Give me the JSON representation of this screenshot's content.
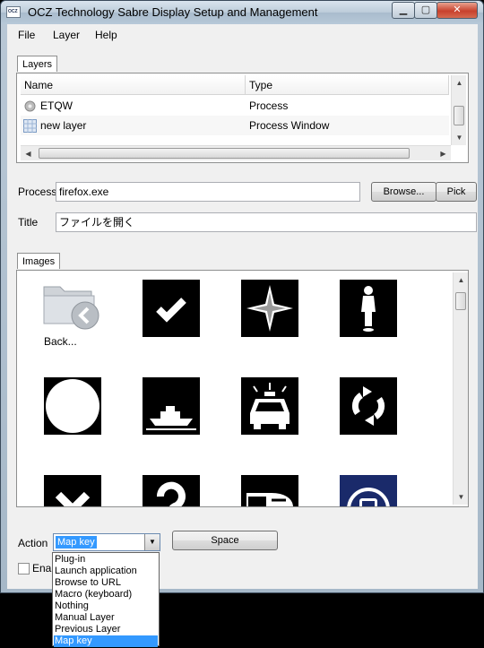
{
  "window": {
    "title": "OCZ Technology Sabre Display Setup and Management",
    "icon_text": "OCZ"
  },
  "menu": [
    "File",
    "Layer",
    "Help"
  ],
  "layers": {
    "tab_label": "Layers",
    "columns": [
      "Name",
      "Type"
    ],
    "rows": [
      {
        "name": "ETQW",
        "type": "Process",
        "icon": "gear-icon"
      },
      {
        "name": "new layer",
        "type": "Process Window",
        "icon": "grid-icon"
      }
    ]
  },
  "process": {
    "label": "Process",
    "value": "firefox.exe",
    "browse_label": "Browse...",
    "pick_label": "Pick"
  },
  "title_field": {
    "label": "Title",
    "value": "ファイルを開く"
  },
  "images": {
    "tab_label": "Images",
    "back_label": "Back...",
    "tiles": [
      "folder-back-icon",
      "checkmark-icon",
      "compass-star-icon",
      "figure-icon",
      "circle-icon",
      "boat-icon",
      "police-car-icon",
      "refresh-arrows-icon",
      "x-icon",
      "question-mark-icon",
      "train-icon",
      "transit-badge-icon"
    ]
  },
  "action": {
    "label": "Action",
    "selected": "Map key",
    "space_label": "Space",
    "options": [
      "Plug-in",
      "Launch application",
      "Browse to URL",
      "Macro (keyboard)",
      "Nothing",
      "Manual Layer",
      "Previous Layer",
      "Map key"
    ]
  },
  "enable": {
    "label": "Enab"
  },
  "colors": {
    "selection": "#3399ff",
    "title_grad": "#bccbd9"
  }
}
